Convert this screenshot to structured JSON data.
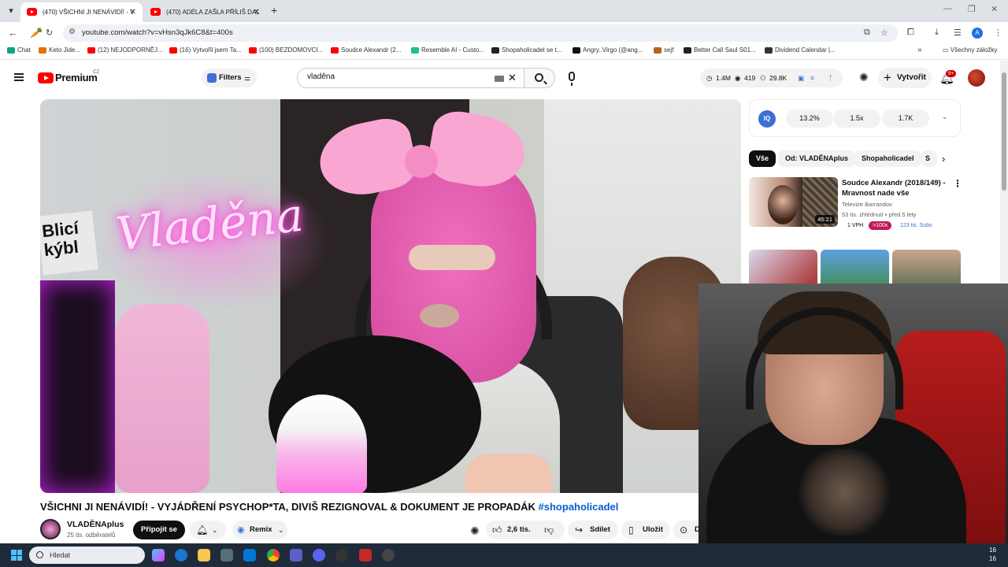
{
  "browser": {
    "tabs": [
      {
        "title": "(470) VŠICHNI JI NENÁVIDÍ! - V",
        "active": true
      },
      {
        "title": "(470) ADÉLA ZAŠLA PŘÍLIŠ DAL",
        "active": false
      }
    ],
    "url": "youtube.com/watch?v=vHsn3qJk6C8&t=400s",
    "bookmarks": [
      {
        "label": "Chat",
        "color": "#10a37f"
      },
      {
        "label": "Keto Jide...",
        "color": "#e57300"
      },
      {
        "label": "(12) NEJODPORNĚJ...",
        "color": "#ff0000"
      },
      {
        "label": "(16) Vytvořil jsem Ta...",
        "color": "#ff0000"
      },
      {
        "label": "(100) BEZDOMOVCI...",
        "color": "#ff0000"
      },
      {
        "label": "Soudce Alexandr (2...",
        "color": "#ff0000"
      },
      {
        "label": "Resemble AI - Custo...",
        "color": "#1fbf8f"
      },
      {
        "label": "Shopaholicadel se t...",
        "color": "#222222"
      },
      {
        "label": "Angry..Virgo (@ang...",
        "color": "#111111"
      },
      {
        "label": "sejf",
        "color": "#b5651d"
      },
      {
        "label": "Better Call Saul S01...",
        "color": "#222222"
      },
      {
        "label": "Dividend Calendar |...",
        "color": "#333333"
      }
    ],
    "all_bookmarks": "Všechny záložky",
    "profile_initial": "A"
  },
  "youtube": {
    "brand": "Premium",
    "country": "CZ",
    "filters_label": "Filters",
    "search_value": "vladěna",
    "stats": {
      "views": "1.4M",
      "watchers": "419",
      "subs": "29.8K"
    },
    "create_label": "Vytvořit",
    "notif_count": "9+"
  },
  "video": {
    "neon_text": "Vladěna",
    "sign_text": "Blicí kýbl",
    "title": "VŠICHNI JI NENÁVIDÍ! - VYJÁDŘENÍ PSYCHOP*TA, DIVIŠ REZIGNOVAL & DOKUMENT JE PROPADÁK",
    "hashtag": "#shopaholicadel",
    "channel": "VLADĚNAplus",
    "subscribers": "25 tis. odběratelů",
    "join_label": "Připojit se",
    "remix_label": "Remix",
    "likes": "2,6 tis.",
    "share_label": "Sdílet",
    "save_label": "Uložit",
    "more_label": "D"
  },
  "sidebar": {
    "iq_logo": "IQ",
    "iq_stats": [
      "13.2%",
      "1.5x",
      "1.7K"
    ],
    "chips": [
      "Vše",
      "Od: VLADĚNAplus",
      "Shopaholicadel",
      "S"
    ],
    "recommendation": {
      "title": "Soudce Alexandr (2018/149) - Mravnost nade vše",
      "channel": "Televize Barrandov",
      "meta": "53 tis. zhlédnutí • před 5 lety",
      "duration": "45:21",
      "vph": "1 VPH",
      "outlier": ">100x",
      "subs": "123 tis. Subs"
    }
  },
  "taskbar": {
    "search_placeholder": "Hledat",
    "clock": [
      "16",
      "16"
    ]
  }
}
